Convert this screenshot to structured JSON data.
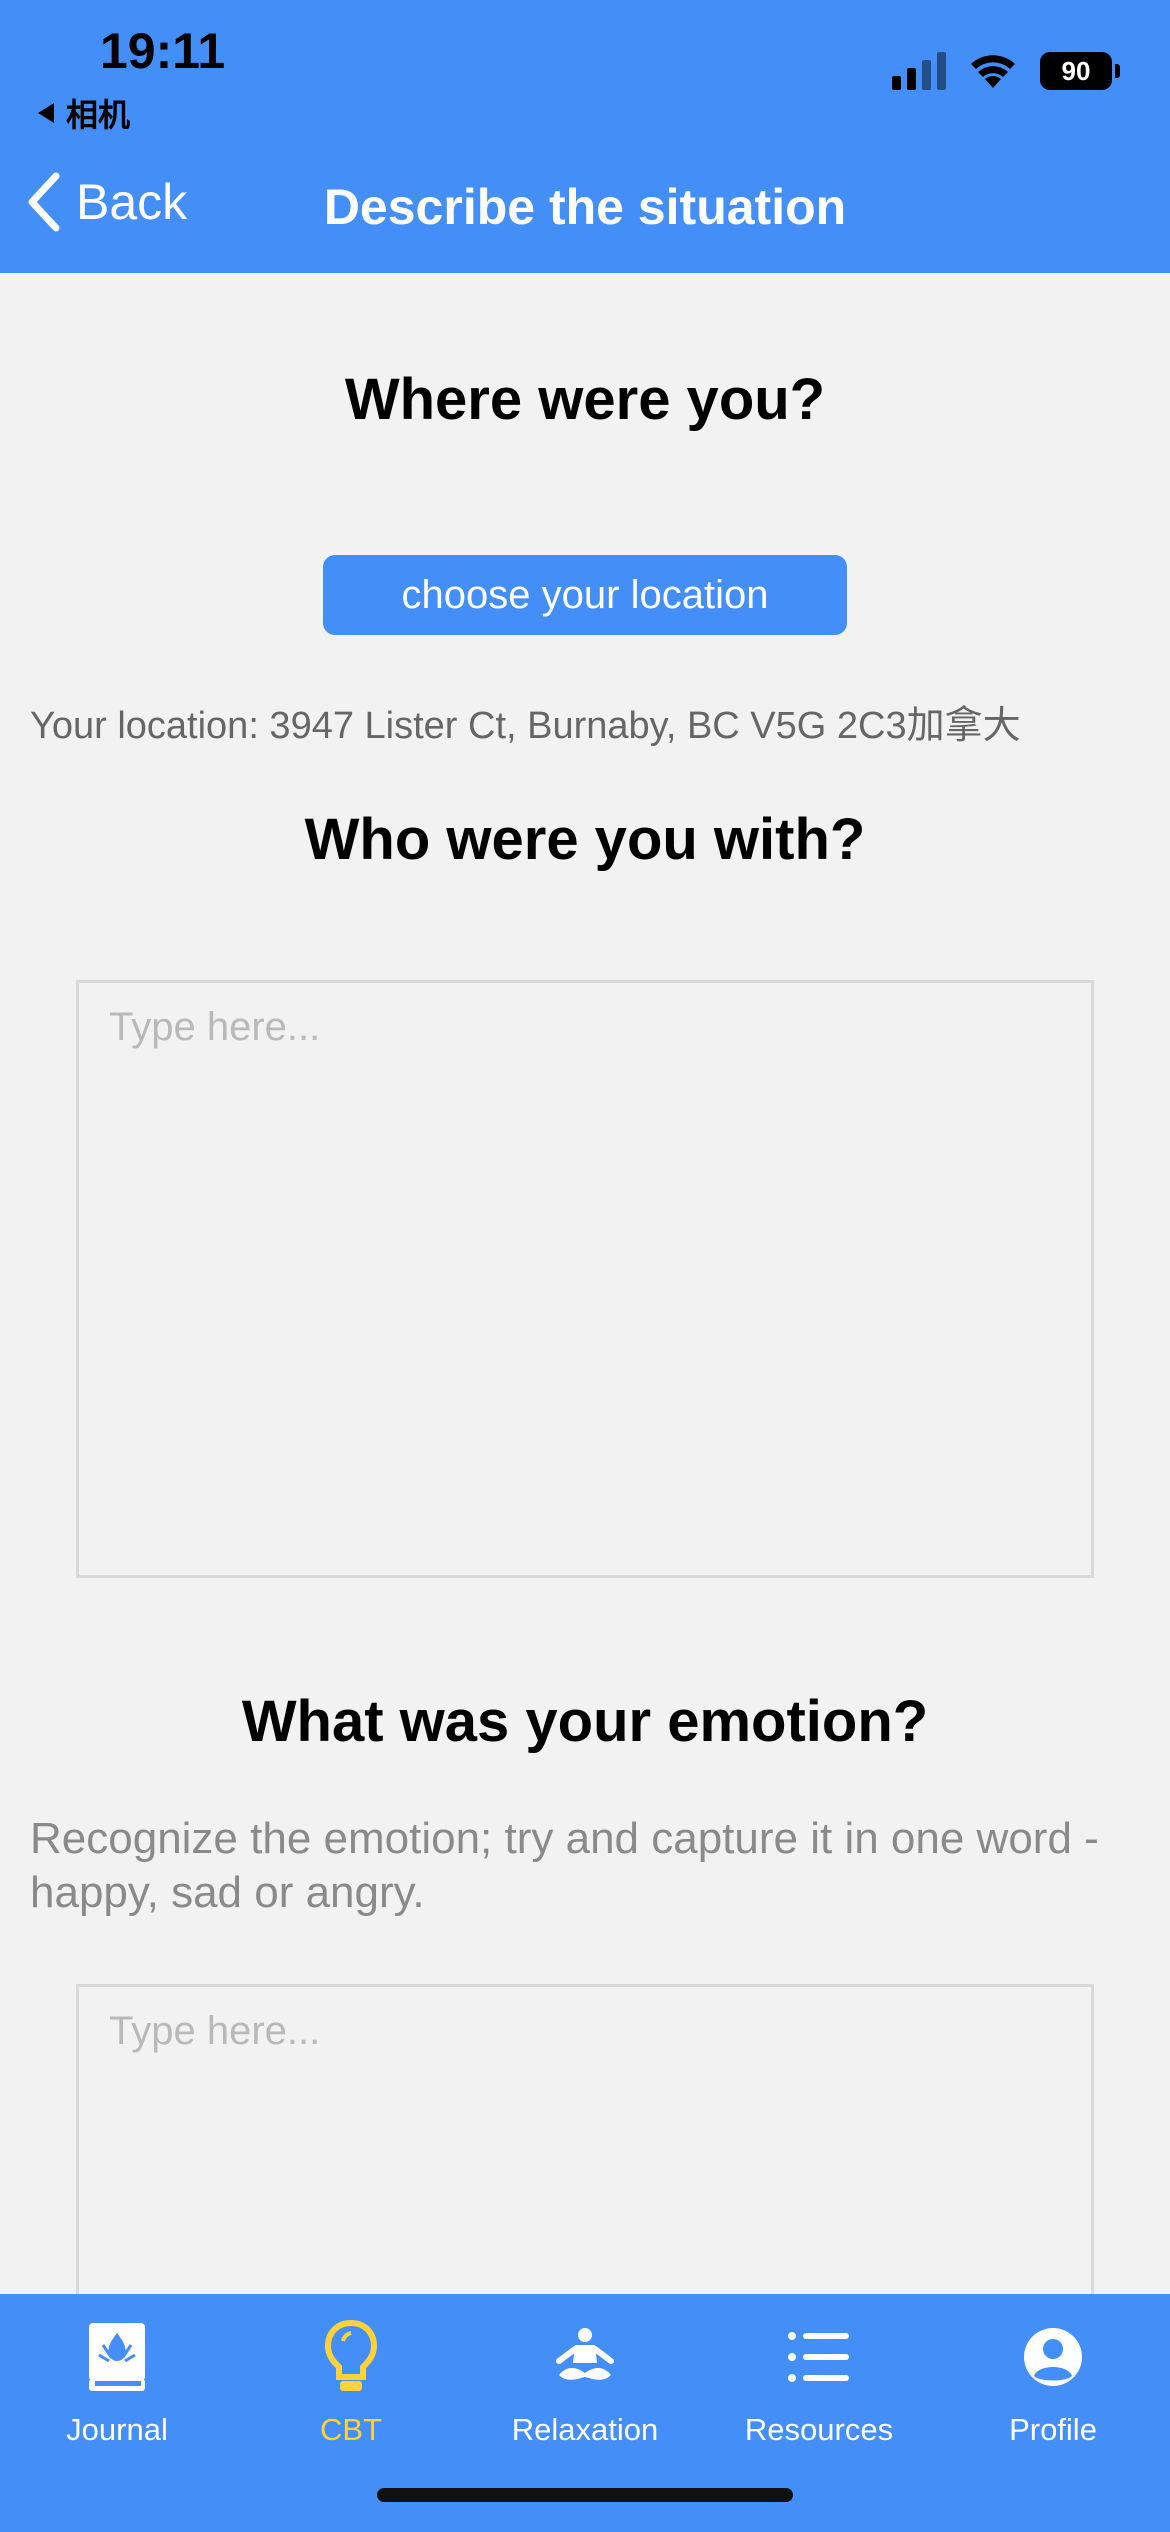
{
  "status": {
    "time": "19:11",
    "back_app": "相机",
    "battery": "90"
  },
  "nav": {
    "back_label": "Back",
    "title": "Describe the situation"
  },
  "location_section": {
    "title": "Where were you?",
    "button_label": "choose your location",
    "location_text": "Your location: 3947 Lister Ct, Burnaby, BC V5G 2C3加拿大"
  },
  "with_section": {
    "title": "Who were you with?",
    "placeholder": "Type here..."
  },
  "emotion_section": {
    "title": "What was your emotion?",
    "hint": "Recognize the emotion; try and capture it in one word - happy, sad or angry.",
    "placeholder": "Type here..."
  },
  "tabs": [
    {
      "label": "Journal",
      "icon": "journal-icon",
      "active": false
    },
    {
      "label": "CBT",
      "icon": "lightbulb-icon",
      "active": true
    },
    {
      "label": "Relaxation",
      "icon": "meditation-icon",
      "active": false
    },
    {
      "label": "Resources",
      "icon": "list-icon",
      "active": false
    },
    {
      "label": "Profile",
      "icon": "profile-icon",
      "active": false
    }
  ],
  "colors": {
    "primary": "#448ef7",
    "active_tab": "#ffd23a",
    "background": "#f2f2f2"
  }
}
